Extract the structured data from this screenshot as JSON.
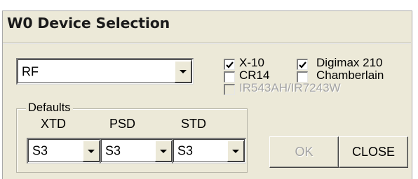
{
  "window": {
    "title": "W0 Device Selection"
  },
  "device_select": {
    "value": "RF"
  },
  "checkboxes": [
    {
      "label": "X-10",
      "checked": true,
      "enabled": true
    },
    {
      "label": "Digimax 210",
      "checked": true,
      "enabled": true
    },
    {
      "label": "CR14",
      "checked": false,
      "enabled": true
    },
    {
      "label": "Chamberlain",
      "checked": false,
      "enabled": true
    },
    {
      "label": "IR543AH/IR7243W",
      "checked": false,
      "enabled": false
    }
  ],
  "defaults": {
    "legend": "Defaults",
    "columns": [
      {
        "header": "XTD",
        "value": "S3"
      },
      {
        "header": "PSD",
        "value": "S3"
      },
      {
        "header": "STD",
        "value": "S3"
      }
    ]
  },
  "buttons": {
    "ok": "OK",
    "close": "CLOSE"
  }
}
